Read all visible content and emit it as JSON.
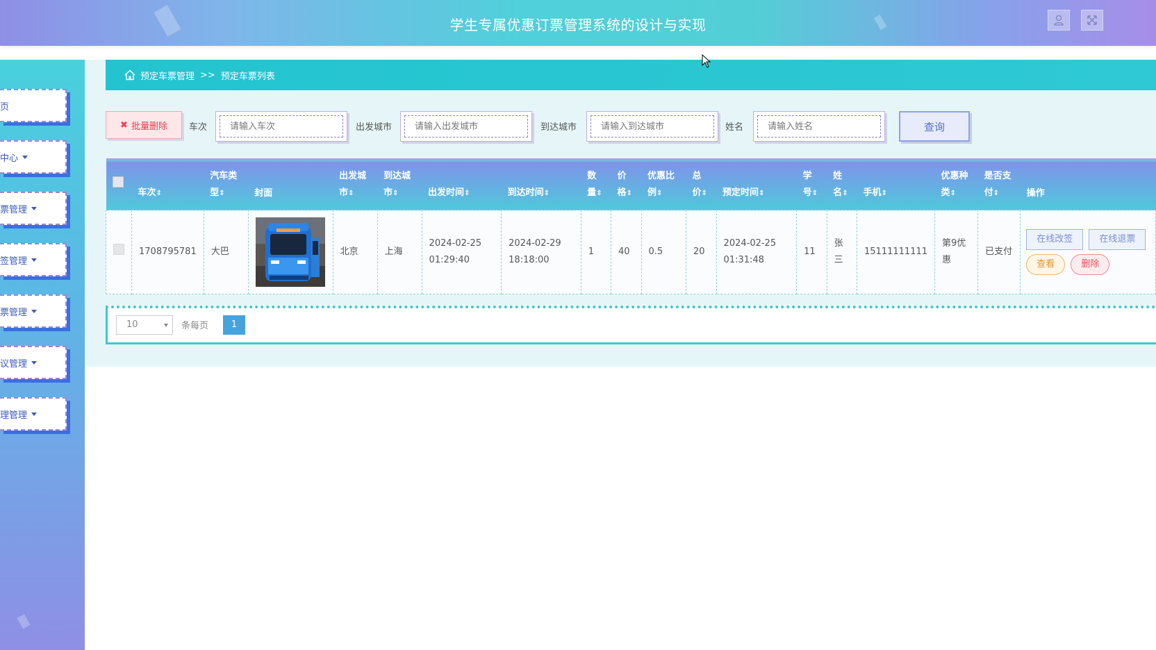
{
  "header": {
    "title": "学生专属优惠订票管理系统的设计与实现",
    "user_icon": "user-icon",
    "fullscreen_icon": "fullscreen-icon"
  },
  "sidebar": {
    "items": [
      {
        "label": "页",
        "has_caret": false
      },
      {
        "label": "中心",
        "has_caret": true
      },
      {
        "label": "票管理",
        "has_caret": true
      },
      {
        "label": "签管理",
        "has_caret": true
      },
      {
        "label": "票管理",
        "has_caret": true
      },
      {
        "label": "议管理",
        "has_caret": true
      },
      {
        "label": "理管理",
        "has_caret": true
      }
    ]
  },
  "breadcrumb": {
    "home_icon": "home-icon",
    "parent": "预定车票管理",
    "separator": ">>",
    "current": "预定车票列表"
  },
  "toolbar": {
    "batch_delete_label": "批量删除",
    "filters": [
      {
        "label": "车次",
        "placeholder": "请输入车次"
      },
      {
        "label": "出发城市",
        "placeholder": "请输入出发城市"
      },
      {
        "label": "到达城市",
        "placeholder": "请输入到达城市"
      },
      {
        "label": "姓名",
        "placeholder": "请输入姓名"
      }
    ],
    "query_label": "查询"
  },
  "table": {
    "columns": [
      {
        "l1": "",
        "l2": "车次",
        "sort": true
      },
      {
        "l1": "汽车类",
        "l2": "型",
        "sort": true
      },
      {
        "l1": "",
        "l2": "封面",
        "sort": false
      },
      {
        "l1": "出发城",
        "l2": "市",
        "sort": true
      },
      {
        "l1": "到达城",
        "l2": "市",
        "sort": true
      },
      {
        "l1": "",
        "l2": "出发时间",
        "sort": true
      },
      {
        "l1": "",
        "l2": "到达时间",
        "sort": true
      },
      {
        "l1": "数",
        "l2": "量",
        "sort": true
      },
      {
        "l1": "价",
        "l2": "格",
        "sort": true
      },
      {
        "l1": "优惠比",
        "l2": "例",
        "sort": true
      },
      {
        "l1": "总",
        "l2": "价",
        "sort": true
      },
      {
        "l1": "",
        "l2": "预定时间",
        "sort": true
      },
      {
        "l1": "学",
        "l2": "号",
        "sort": true
      },
      {
        "l1": "姓",
        "l2": "名",
        "sort": true
      },
      {
        "l1": "",
        "l2": "手机",
        "sort": true
      },
      {
        "l1": "优惠种",
        "l2": "类",
        "sort": true
      },
      {
        "l1": "是否支",
        "l2": "付",
        "sort": true
      },
      {
        "l1": "",
        "l2": "操作",
        "sort": false
      }
    ],
    "sort_glyph": "⇕",
    "rows": [
      {
        "train_no": "1708795781",
        "bus_type": "大巴",
        "cover": "bus-photo",
        "depart_city": "北京",
        "arrive_city": "上海",
        "depart_date": "2024-02-25",
        "depart_time": "01:29:40",
        "arrive_date": "2024-02-29",
        "arrive_time": "18:18:00",
        "quantity": "1",
        "price": "40",
        "discount": "0.5",
        "total": "20",
        "book_date": "2024-02-25",
        "book_time": "01:31:48",
        "student_no": "11",
        "name_1": "张",
        "name_2": "三",
        "phone": "15111111111",
        "discount_type_1": "第9优",
        "discount_type_2": "惠",
        "paid": "已支付",
        "actions": {
          "edit": "在线改签",
          "refund": "在线退票",
          "view": "查看",
          "delete": "删除"
        }
      }
    ]
  },
  "pager": {
    "page_size": "10",
    "per_page_label": "条每页",
    "current_page": "1"
  },
  "colors": {
    "accent": "#2ec9d4",
    "header_gradient_start": "#8f8fe6",
    "header_gradient_mid": "#4fd0da",
    "danger": "#e8414e",
    "page_active": "#47a3dc"
  }
}
